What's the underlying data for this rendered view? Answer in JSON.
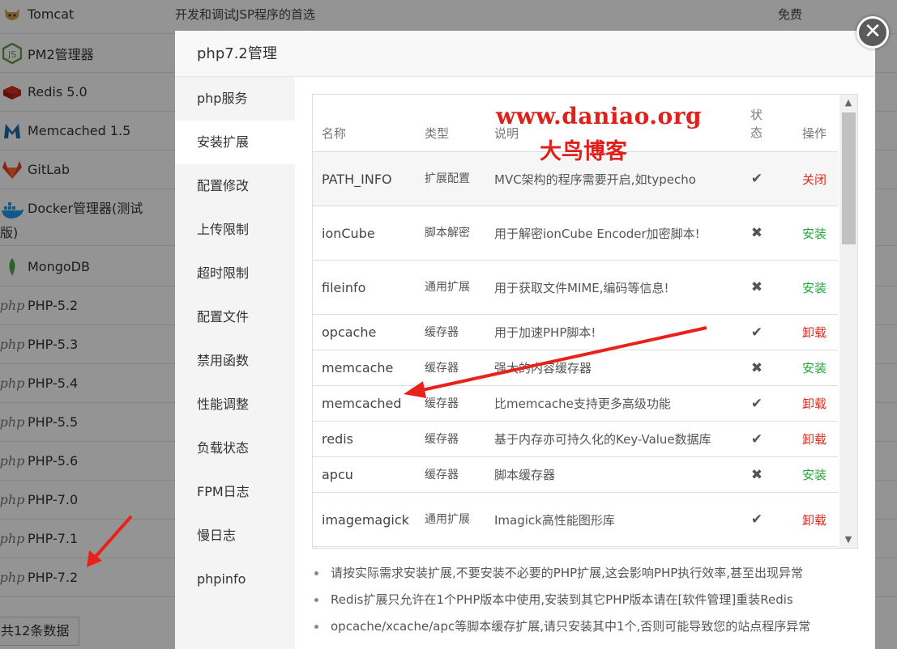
{
  "background": {
    "apps": [
      {
        "name": "Tomcat",
        "icon": "tomcat-icon",
        "desc": "开发和调试JSP程序的首选",
        "price": "免费"
      },
      {
        "name": "PM2管理器",
        "icon": "nodejs-icon"
      },
      {
        "name": "Redis 5.0",
        "icon": "redis-icon"
      },
      {
        "name": "Memcached 1.5",
        "icon": "memcached-icon"
      },
      {
        "name": "GitLab",
        "icon": "gitlab-icon"
      },
      {
        "name": "Docker管理器(测试",
        "name2": "版)",
        "icon": "docker-icon"
      },
      {
        "name": "MongoDB",
        "icon": "mongodb-icon"
      },
      {
        "name": "PHP-5.2",
        "icon": "php-icon"
      },
      {
        "name": "PHP-5.3",
        "icon": "php-icon"
      },
      {
        "name": "PHP-5.4",
        "icon": "php-icon"
      },
      {
        "name": "PHP-5.5",
        "icon": "php-icon"
      },
      {
        "name": "PHP-5.6",
        "icon": "php-icon"
      },
      {
        "name": "PHP-7.0",
        "icon": "php-icon"
      },
      {
        "name": "PHP-7.1",
        "icon": "php-icon"
      },
      {
        "name": "PHP-7.2",
        "icon": "php-icon"
      }
    ],
    "php_logo_text": "php",
    "total_label": "共12条数据"
  },
  "modal": {
    "title": "php7.2管理",
    "close_glyph": "✕",
    "menu": [
      {
        "label": "php服务"
      },
      {
        "label": "安装扩展",
        "active": true
      },
      {
        "label": "配置修改"
      },
      {
        "label": "上传限制"
      },
      {
        "label": "超时限制"
      },
      {
        "label": "配置文件"
      },
      {
        "label": "禁用函数"
      },
      {
        "label": "性能调整"
      },
      {
        "label": "负载状态"
      },
      {
        "label": "FPM日志"
      },
      {
        "label": "慢日志"
      },
      {
        "label": "phpinfo"
      }
    ],
    "table": {
      "headers": {
        "name": "名称",
        "type": "类型",
        "desc": "说明",
        "status_1": "状",
        "status_2": "态",
        "action": "操作"
      },
      "rows": [
        {
          "name": "PATH_INFO",
          "type": "扩展配置",
          "desc": "MVC架构的程序需要开启,如typecho",
          "status": "✔",
          "action": "关闭",
          "action_color": "red"
        },
        {
          "name": "ionCube",
          "type": "脚本解密",
          "desc": "用于解密ionCube Encoder加密脚本!",
          "status": "✖",
          "action": "安装",
          "action_color": "green"
        },
        {
          "name": "fileinfo",
          "type": "通用扩展",
          "desc": "用于获取文件MIME,编码等信息!",
          "status": "✖",
          "action": "安装",
          "action_color": "green"
        },
        {
          "name": "opcache",
          "type": "缓存器",
          "desc": "用于加速PHP脚本!",
          "status": "✔",
          "action": "卸载",
          "action_color": "red"
        },
        {
          "name": "memcache",
          "type": "缓存器",
          "desc": "强大的内容缓存器",
          "status": "✖",
          "action": "安装",
          "action_color": "green"
        },
        {
          "name": "memcached",
          "type": "缓存器",
          "desc": "比memcache支持更多高级功能",
          "status": "✔",
          "action": "卸载",
          "action_color": "red"
        },
        {
          "name": "redis",
          "type": "缓存器",
          "desc": "基于内存亦可持久化的Key-Value数据库",
          "status": "✔",
          "action": "卸载",
          "action_color": "red"
        },
        {
          "name": "apcu",
          "type": "缓存器",
          "desc": "脚本缓存器",
          "status": "✖",
          "action": "安装",
          "action_color": "green"
        },
        {
          "name": "imagemagick",
          "type": "通用扩展",
          "desc": "Imagick高性能图形库",
          "status": "✔",
          "action": "卸载",
          "action_color": "red"
        }
      ]
    },
    "notes": [
      "请按实际需求安装扩展,不要安装不必要的PHP扩展,这会影响PHP执行效率,甚至出现异常",
      "Redis扩展只允许在1个PHP版本中使用,安装到其它PHP版本请在[软件管理]重装Redis",
      "opcache/xcache/apc等脚本缓存扩展,请只安装其中1个,否则可能导致您的站点程序异常"
    ]
  },
  "watermark": {
    "url": "www.daniao.org",
    "name": "大鸟博客"
  },
  "colors": {
    "danger": "#e02a1e",
    "success": "#20a53a",
    "arrow": "#e8221a"
  }
}
